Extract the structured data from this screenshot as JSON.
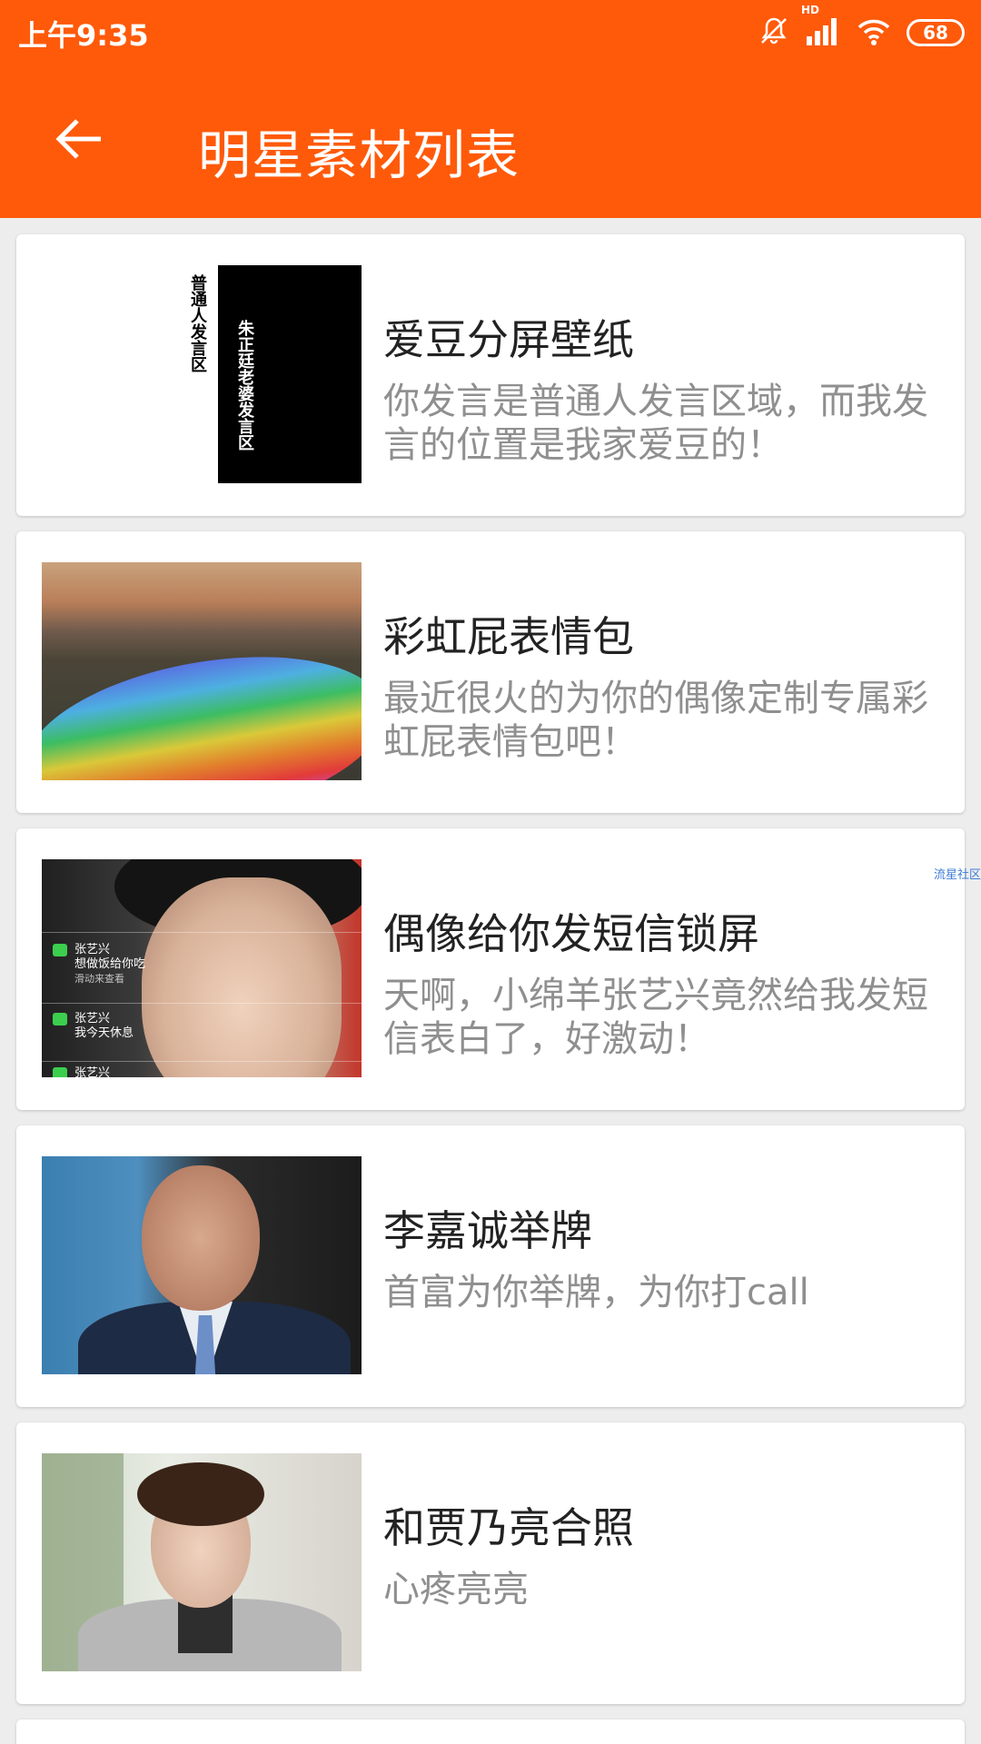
{
  "status_bar": {
    "time": "上午9:35",
    "hd": "HD",
    "battery": "68",
    "icons": [
      "mute-bell-icon",
      "signal-icon",
      "wifi-icon",
      "battery-icon"
    ]
  },
  "app_bar": {
    "title": "明星素材列表",
    "back_icon": "arrow-left-icon"
  },
  "colors": {
    "accent": "#ff5a0a",
    "title_text": "#222222",
    "desc_text": "#8f8f8f",
    "background": "#ededed"
  },
  "items": [
    {
      "title": "爱豆分屏壁纸",
      "desc": "你发言是普通人发言区域，而我发言的位置是我家爱豆的！",
      "thumb_left_text": "普通人发言区",
      "thumb_right_text": "朱正廷老婆发言区"
    },
    {
      "title": "彩虹屁表情包",
      "desc": "最近很火的为你的偶像定制专属彩虹屁表情包吧！"
    },
    {
      "title": "偶像给你发短信锁屏",
      "desc": "天啊，小绵羊张艺兴竟然给我发短信表白了，好激动！",
      "thumb_messages": [
        {
          "name": "张艺兴",
          "text": "想做饭给你吃",
          "sub": "滑动来查看"
        },
        {
          "name": "张艺兴",
          "text": "我今天休息"
        },
        {
          "name": "张艺兴"
        }
      ]
    },
    {
      "title": "李嘉诚举牌",
      "desc": "首富为你举牌，为你打call"
    },
    {
      "title": "和贾乃亮合照",
      "desc": "心疼亮亮"
    }
  ],
  "watermark": "流星社区"
}
